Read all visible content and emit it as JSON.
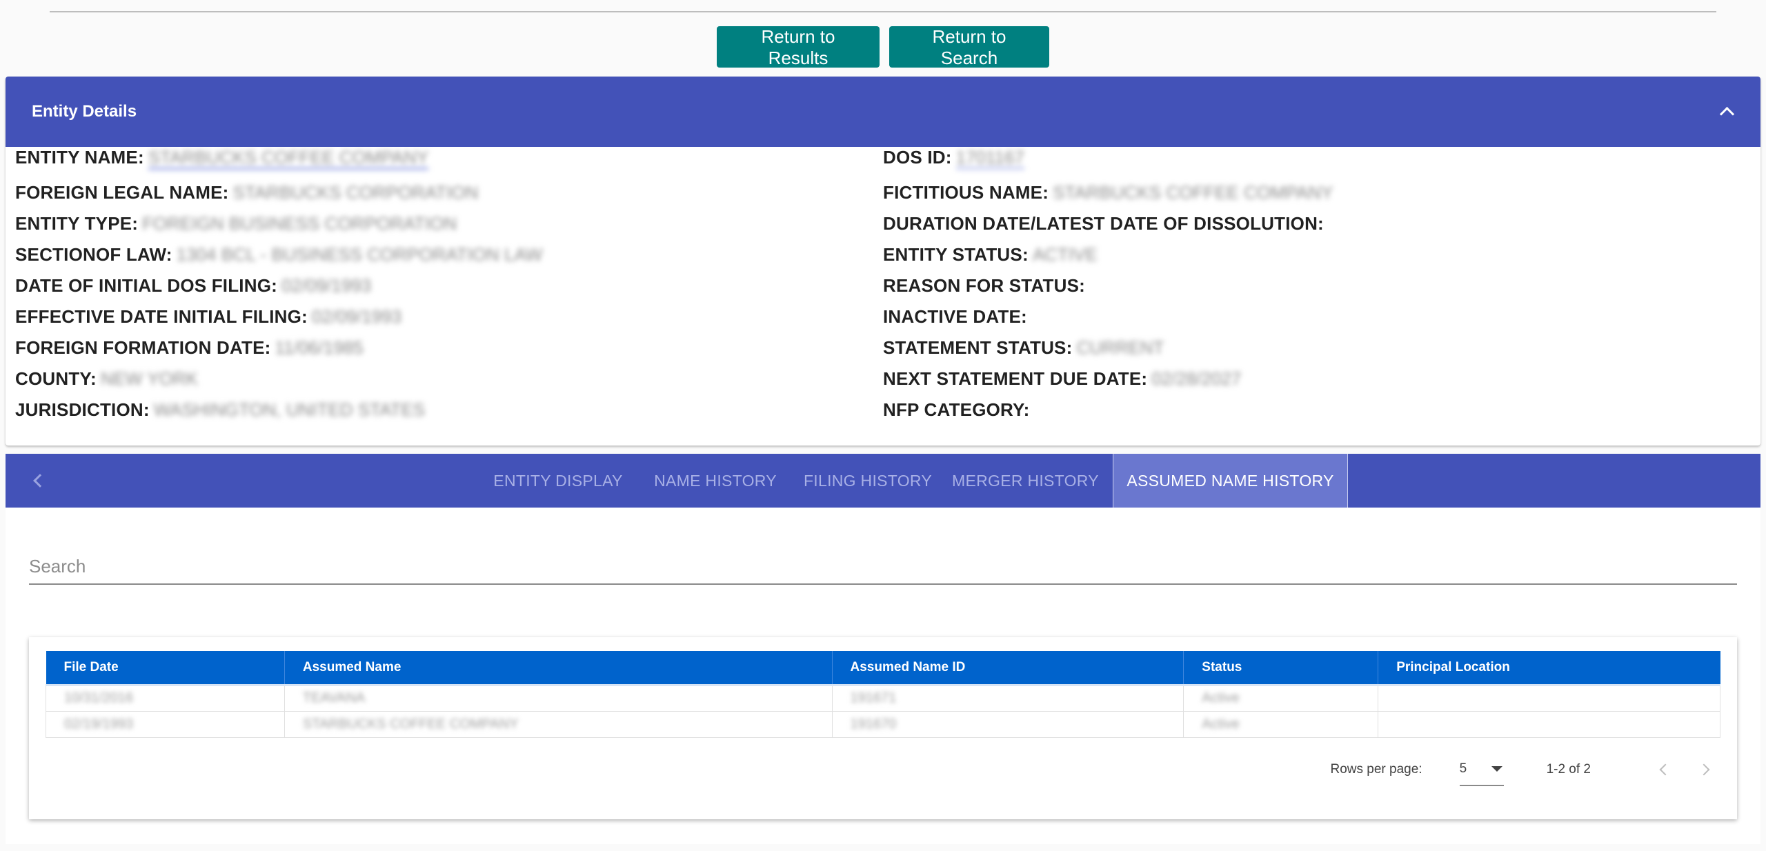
{
  "actions": {
    "return_results": "Return to Results",
    "return_search": "Return to Search"
  },
  "entity_details": {
    "title": "Entity Details",
    "left": [
      {
        "label": "ENTITY NAME:",
        "value": "STARBUCKS COFFEE COMPANY"
      },
      {
        "label": "FOREIGN LEGAL NAME:",
        "value": "STARBUCKS CORPORATION"
      },
      {
        "label": "ENTITY TYPE:",
        "value": "FOREIGN BUSINESS CORPORATION"
      },
      {
        "label": "SECTIONOF LAW:",
        "value": "1304 BCL - BUSINESS CORPORATION LAW"
      },
      {
        "label": "DATE OF INITIAL DOS FILING:",
        "value": "02/09/1993"
      },
      {
        "label": "EFFECTIVE DATE INITIAL FILING:",
        "value": "02/09/1993"
      },
      {
        "label": "FOREIGN FORMATION DATE:",
        "value": "11/06/1985"
      },
      {
        "label": "COUNTY:",
        "value": "NEW YORK"
      },
      {
        "label": "JURISDICTION:",
        "value": "WASHINGTON, UNITED STATES"
      }
    ],
    "right": [
      {
        "label": "DOS ID:",
        "value": "1701167"
      },
      {
        "label": "FICTITIOUS NAME:",
        "value": "STARBUCKS COFFEE COMPANY"
      },
      {
        "label": "DURATION DATE/LATEST DATE OF DISSOLUTION:",
        "value": ""
      },
      {
        "label": "ENTITY STATUS:",
        "value": "ACTIVE"
      },
      {
        "label": "REASON FOR STATUS:",
        "value": ""
      },
      {
        "label": "INACTIVE DATE:",
        "value": ""
      },
      {
        "label": "STATEMENT STATUS:",
        "value": "CURRENT"
      },
      {
        "label": "NEXT STATEMENT DUE DATE:",
        "value": "02/28/2027"
      },
      {
        "label": "NFP CATEGORY:",
        "value": ""
      }
    ]
  },
  "tabs": [
    {
      "label": "ENTITY DISPLAY",
      "active": false
    },
    {
      "label": "NAME HISTORY",
      "active": false
    },
    {
      "label": "FILING HISTORY",
      "active": false
    },
    {
      "label": "MERGER HISTORY",
      "active": false
    },
    {
      "label": "ASSUMED NAME HISTORY",
      "active": true
    }
  ],
  "search": {
    "placeholder": "Search"
  },
  "table": {
    "columns": [
      "File Date",
      "Assumed Name",
      "Assumed Name ID",
      "Status",
      "Principal Location"
    ],
    "rows": [
      [
        "10/31/2016",
        "TEAVANA",
        "191671",
        "Active",
        ""
      ],
      [
        "02/19/1993",
        "STARBUCKS COFFEE COMPANY",
        "191670",
        "Active",
        ""
      ]
    ]
  },
  "pagination": {
    "rows_per_page_label": "Rows per page:",
    "rows_per_page": "5",
    "range": "1-2 of 2"
  }
}
